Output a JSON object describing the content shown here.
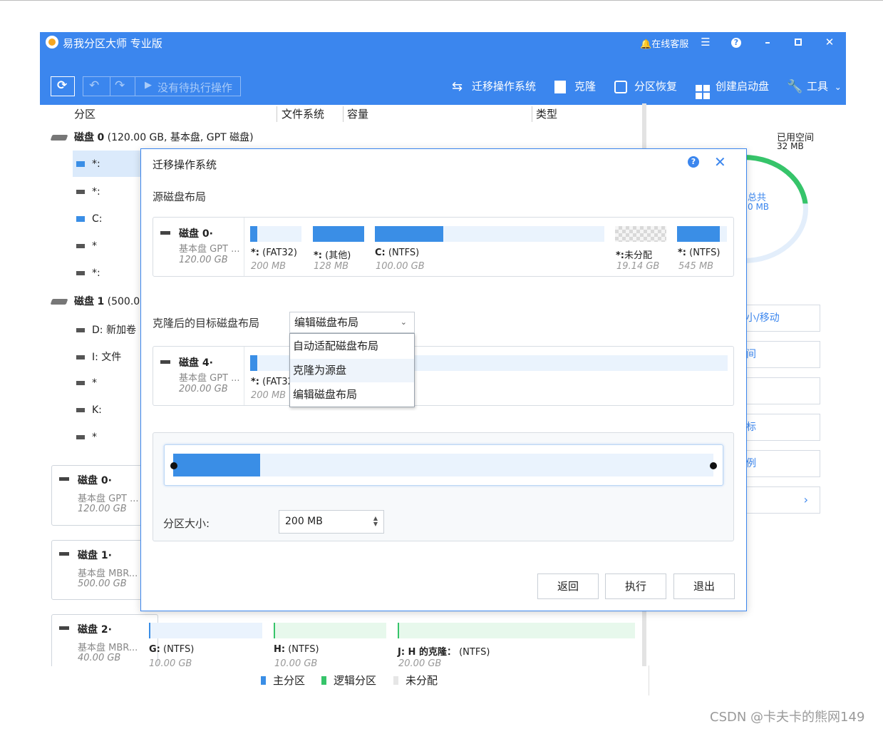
{
  "app": {
    "title": "易我分区大师 专业版",
    "online_service": "在线客服",
    "no_pending": "没有待执行操作",
    "actions": [
      "迁移操作系统",
      "克隆",
      "分区恢复",
      "创建启动盘",
      "工具"
    ]
  },
  "table": {
    "columns": [
      "分区",
      "文件系统",
      "容量",
      "类型"
    ]
  },
  "tree": {
    "disk0": {
      "name": "磁盘",
      "num": "0",
      "info": "(120.00 GB, 基本盘, GPT 磁盘)"
    },
    "disk0_parts": [
      "*:",
      "*:",
      "C:",
      "*",
      "*:"
    ],
    "disk1": {
      "name": "磁盘",
      "num": "1",
      "info": "(500.0"
    },
    "disk1_parts": [
      "D: 新加卷",
      "I: 文件",
      "*",
      "K:",
      "*"
    ]
  },
  "cards": [
    {
      "title": "磁盘 0·",
      "sub1": "基本盘 GPT ...",
      "sub2": "120.00 GB"
    },
    {
      "title": "磁盘 1·",
      "sub1": "基本盘 MBR...",
      "sub2": "500.00 GB"
    },
    {
      "title": "磁盘 2·",
      "sub1": "基本盘 MBR...",
      "sub2": "40.00 GB"
    }
  ],
  "disk2_parts": [
    {
      "label": "G:",
      "fs": "(NTFS)",
      "size": "10.00 GB"
    },
    {
      "label": "H:",
      "fs": "(NTFS)",
      "size": "10.00 GB"
    },
    {
      "label": "J: H 的克隆：",
      "fs": "(NTFS)",
      "size": "20.00 GB"
    }
  ],
  "right_panel": {
    "used_label": "已用空间",
    "used_value": "32 MB",
    "total_label": "总共",
    "total_value": "0 MB",
    "buttons": [
      "小/移动",
      "间",
      "",
      "标",
      "例",
      ""
    ],
    "more": "›"
  },
  "dialog": {
    "title": "迁移操作系统",
    "help": "?",
    "close": "✕",
    "source_label": "源磁盘布局",
    "source_disk": {
      "title": "磁盘 0·",
      "sub1": "基本盘 GPT ...",
      "sub2": "120.00 GB"
    },
    "source_parts": [
      {
        "label": "*:",
        "fs": "(FAT32)",
        "size": "200 MB"
      },
      {
        "label": "*:",
        "fs": "(其他)",
        "size": "128 MB"
      },
      {
        "label": "C:",
        "fs": "(NTFS)",
        "size": "100.00 GB"
      },
      {
        "label": "*:",
        "fs": "未分配",
        "size": "19.14 GB"
      },
      {
        "label": "*:",
        "fs": "(NTFS)",
        "size": "545 MB"
      }
    ],
    "target_label": "克隆后的目标磁盘布局",
    "select_value": "编辑磁盘布局",
    "dropdown_options": [
      "自动适配磁盘布局",
      "克隆为源盘",
      "编辑磁盘布局"
    ],
    "target_disk": {
      "title": "磁盘 4·",
      "sub1": "基本盘 GPT ...",
      "sub2": "200.00 GB"
    },
    "target_part": {
      "label": "*:",
      "fs": "(FAT32",
      "size": "200 MB"
    },
    "partition_size_label": "分区大小:",
    "partition_size_value": "200 MB",
    "buttons": {
      "back": "返回",
      "execute": "执行",
      "exit": "退出"
    }
  },
  "legend": [
    "主分区",
    "逻辑分区",
    "未分配"
  ],
  "watermark": "CSDN @卡夫卡的熊网149",
  "colors": {
    "accent": "#3b86ee",
    "primary_part": "#3a8ee6",
    "logical_part": "#36c46a"
  }
}
